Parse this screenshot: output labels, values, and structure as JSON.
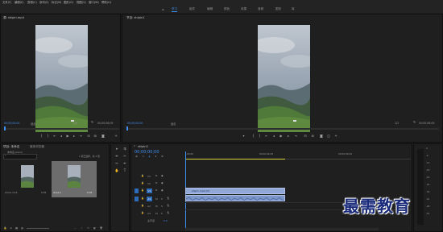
{
  "menu": [
    "文件(F)",
    "编辑(E)",
    "剪辑(C)",
    "序列(S)",
    "标记(M)",
    "图形(G)",
    "视图(V)",
    "窗口(W)",
    "帮助(H)"
  ],
  "workspaces": [
    "学习",
    "组件",
    "编辑",
    "颜色",
    "效果",
    "音频",
    "图形",
    "库"
  ],
  "source_panel": {
    "title": "源: shipin.mp4",
    "timecode_left": "00;00;00;00",
    "fit": "适合",
    "fraction": "1/2",
    "timecode_right": "00;00;06;09"
  },
  "program_panel": {
    "title": "节目: shipin1",
    "timecode_left": "00;00;00;00",
    "fit": "适合",
    "fraction": "1/2",
    "timecode_right": "00;00;06;09"
  },
  "project_panel": {
    "tabs": [
      "项目: 未命名",
      "媒体浏览器"
    ],
    "project_file": "未命名.prproj",
    "item_count": "1 项已选择，共 2 项",
    "items": [
      {
        "name": "shipin.mp4",
        "duration": "6;09"
      },
      {
        "name": "shipin1",
        "duration": "6;09"
      }
    ]
  },
  "timeline": {
    "sequence_tab": "shipin1",
    "timecode": "00;00;00;00",
    "ruler": [
      ";00;00",
      "00;00;04;29",
      "00;00;09;29"
    ],
    "tracks": [
      {
        "label": "V3"
      },
      {
        "label": "V2"
      },
      {
        "label": "V1"
      },
      {
        "label": "A1"
      },
      {
        "label": "A2"
      },
      {
        "label": "A3"
      }
    ],
    "clip_name": "shipin.mp4 [V]",
    "master_label": "主声道",
    "master_value": "0.0"
  },
  "audio_meter": {
    "labels": [
      "0",
      "-6",
      "-12",
      "-18",
      "-24",
      "-30",
      "-36",
      "-42",
      "-48",
      "-54"
    ]
  },
  "watermark": "最需教育",
  "colors": {
    "accent": "#3f8ff0",
    "clip_video": "#8fa8d8",
    "work_area": "#d8d23a",
    "background": "#1d1d1d"
  }
}
